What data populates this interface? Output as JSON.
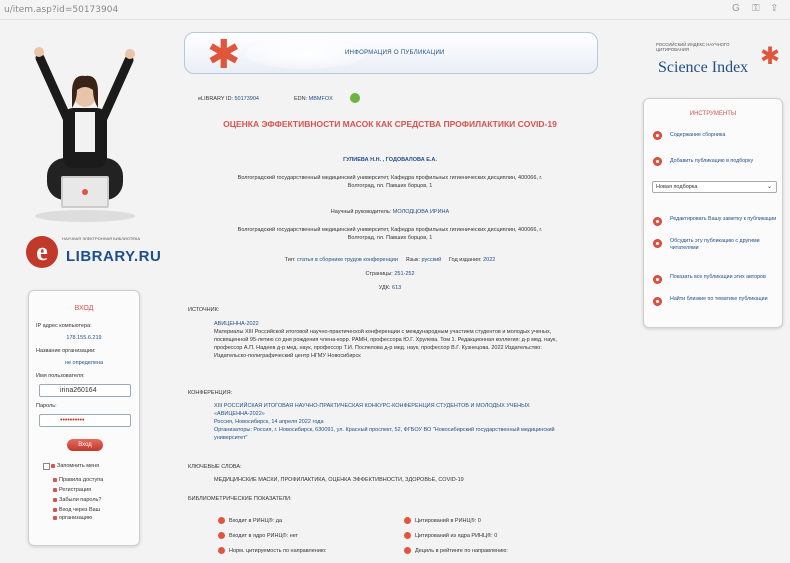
{
  "browser": {
    "url": "u/item.asp?id=50173904",
    "icons": [
      "google-icon",
      "key-icon",
      "share-icon"
    ]
  },
  "left": {
    "logo_small": "НАУЧНАЯ ЭЛЕКТРОННАЯ БИБЛИОТЕКА",
    "logo_main": "LIBRARY.RU",
    "login": {
      "title": "ВХОД",
      "ip_label": "IP адрес компьютера:",
      "ip_value": "178.155.6.219",
      "org_label": "Название организации:",
      "org_value": "не определена",
      "user_label": "Имя пользователя:",
      "user_value": "irina260164",
      "pass_label": "Пароль:",
      "pass_value": "••••••••••",
      "button": "Вход",
      "remember": "Запомнить меня",
      "links": [
        "Правила доступа",
        "Регистрация",
        "Забыли пароль?",
        "Вход через Ваш",
        "организацию"
      ]
    }
  },
  "header": {
    "title": "ИНФОРМАЦИЯ О ПУБЛИКАЦИИ"
  },
  "article": {
    "edn_label": "eLIBRARY ID:",
    "edn_value": "50173904",
    "edn2_label": "EDN:",
    "edn2_value": "MBMFOX",
    "title": "ОЦЕНКА ЭФФЕКТИВНОСТИ МАСОК КАК СРЕДСТВА ПРОФИЛАКТИКИ COVID-19",
    "authors": "ГУЛИЕВА Н.Н. , ГОДОВАЛОВА Е.А.",
    "affiliation1": "Волгоградский государственный медицинский университет, Кафедра профильных гигиенических дисциплин, 400066, г. Волгоград, пл. Павших борцов, 1",
    "supervisor_label": "Научный руководитель:",
    "supervisor": "МОЛОДЦОВА ИРИНА",
    "affiliation2": "Волгоградский государственный медицинский университет, Кафедра профильных гигиенических дисциплин, 400066, г. Волгоград, пл. Павших борцов, 1",
    "type_label": "Тип:",
    "type_value": "статья в сборнике трудов конференции",
    "lang_label": "Язык:",
    "lang_value": "русский",
    "year_label": "Год издания:",
    "year_value": "2022",
    "pages_label": "Страницы:",
    "pages_value": "251-252",
    "udk_label": "УДК:",
    "udk_value": "613"
  },
  "source": {
    "label": "ИСТОЧНИК:",
    "name": "АВИЦЕННА-2022",
    "desc": "Материалы XIII Российской итоговой научно-практической конференции с международным участием студентов и молодых ученых, посвященной 95-летию со дня рождения члена-корр. РАМН, профессора Ю.Г. Хрулева. Том 1. Редакционная коллегия: д-р мед. наук, профессор А.П. Надеев д-р мед. наук, профессор Т.И. Поспелова д-р мед. наук, профессор В.Г. Кузнецова. 2022 Издательство: Издательско-полиграфический центр НГМУ Новосибирск"
  },
  "conference": {
    "label": "КОНФЕРЕНЦИЯ:",
    "name": "XIII РОССИЙСКАЯ ИТОГОВАЯ НАУЧНО-ПРАКТИЧЕСКАЯ КОНКУРС-КОНФЕРЕНЦИЯ СТУДЕНТОВ И МОЛОДЫХ УЧЕНЫХ «АВИЦЕННА-2022»",
    "details": "Россия, Новосибирск, 14 апреля 2022 года",
    "org": "Организаторы: Россия, г. Новосибирск, 630091, ул. Красный проспект, 52, ФГБОУ ВО \"Новосибирский государственный медицинский университет\""
  },
  "keywords": {
    "label": "КЛЮЧЕВЫЕ СЛОВА:",
    "value": "МЕДИЦИНСКИЕ МАСКИ, ПРОФИЛАКТИКА, ОЦЕНКА ЭФФЕКТИВНОСТИ, ЗДОРОВЬЕ, COVID-19"
  },
  "metrics": {
    "label": "БИБЛИОМЕТРИЧЕСКИЕ ПОКАЗАТЕЛИ:",
    "items": [
      "Входит в РИНЦ®: да",
      "Цитирований в РИНЦ®: 0",
      "Входит в ядро РИНЦ®: нет",
      "Цитирований из ядра РИНЦ®: 0",
      "Норм. цитируемость по направлению:",
      "Дециль в рейтинге по направлению:"
    ]
  },
  "right": {
    "sindex_small": "РОССИЙСКИЙ ИНДЕКС НАУЧНОГО ЦИТИРОВАНИЯ",
    "sindex_big": "Science Index",
    "tools_title": "ИНСТРУМЕНТЫ",
    "tools": [
      "Содержание сборника",
      "Добавить публикацию в подборку",
      "Редактировать Вашу заметку к публикации",
      "Обсудить эту публикацию с другими читателями",
      "Показать все публикации этих авторов",
      "Найти близкие по тематике публикации"
    ],
    "select_value": "Новая подборка"
  }
}
